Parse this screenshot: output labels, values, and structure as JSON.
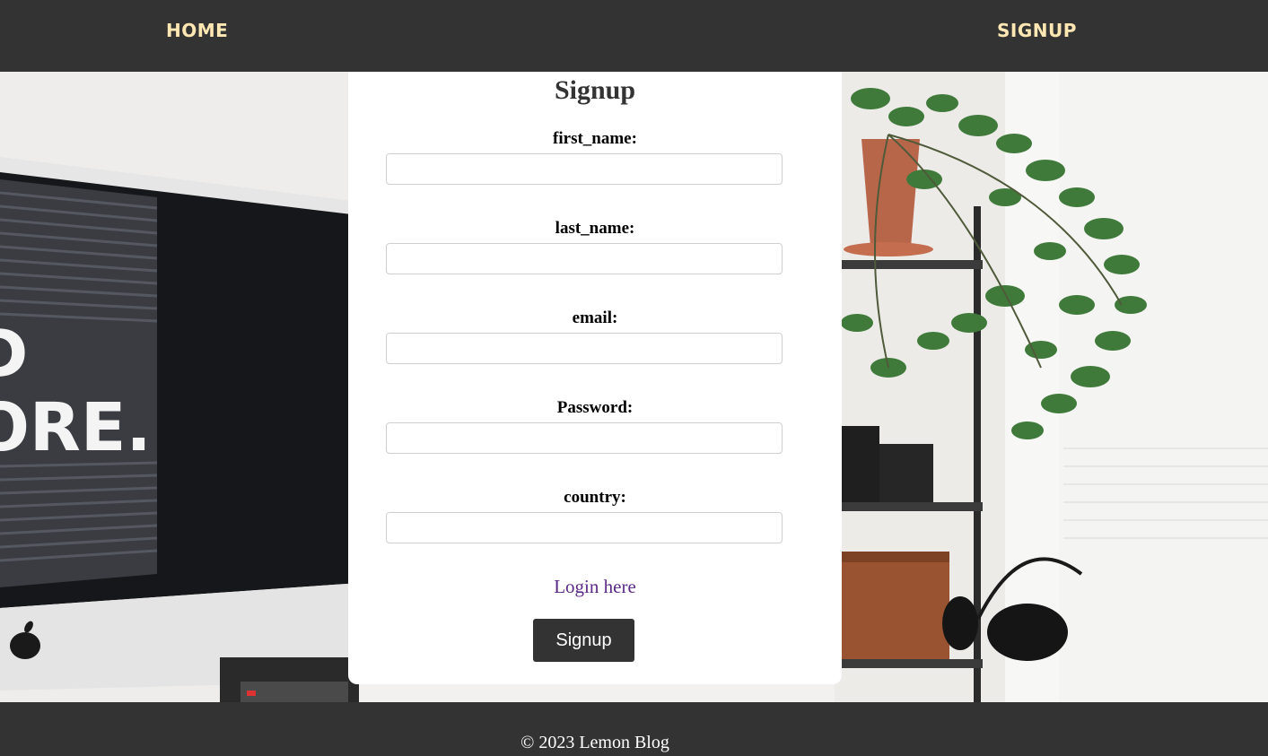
{
  "nav": {
    "home_label": "HOME",
    "signup_label": "SIGNUP"
  },
  "background": {
    "monitor_text_line1": "D",
    "monitor_text_line2": "ORE.",
    "apple_logo_icon": "apple-logo-icon"
  },
  "form": {
    "title": "Signup",
    "fields": [
      {
        "label": "first_name:",
        "value": "",
        "placeholder": ""
      },
      {
        "label": "last_name:",
        "value": "",
        "placeholder": ""
      },
      {
        "label": "email:",
        "value": "",
        "placeholder": ""
      },
      {
        "label": "Password:",
        "value": "",
        "placeholder": ""
      },
      {
        "label": "country:",
        "value": "",
        "placeholder": ""
      }
    ],
    "login_link": "Login here",
    "submit_label": "Signup"
  },
  "footer": {
    "text": "© 2023 Lemon Blog"
  },
  "colors": {
    "nav_bg": "#333333",
    "nav_text": "#ffe7b3",
    "button_bg": "#333333",
    "link": "#5b2a86"
  }
}
